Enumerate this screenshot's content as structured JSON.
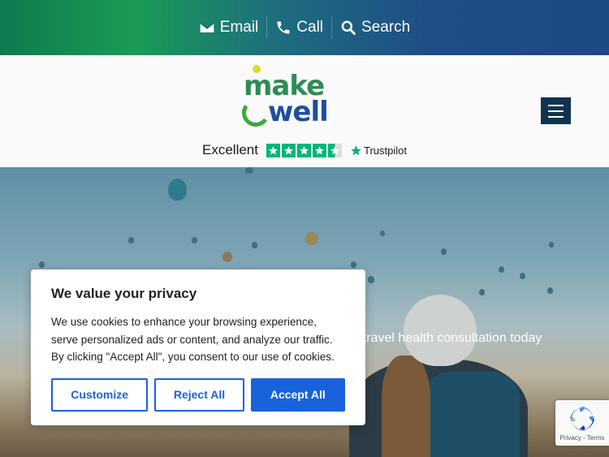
{
  "topbar": {
    "email_label": "Email",
    "call_label": "Call",
    "search_label": "Search"
  },
  "header": {
    "logo_top": "make",
    "logo_bottom": "well",
    "trust_label": "Excellent",
    "trust_brand": "Trustpilot",
    "rating_stars": 4.5
  },
  "hero": {
    "tagline_fragment": "r travel health consultation today"
  },
  "cookie": {
    "title": "We value your privacy",
    "body": "We use cookies to enhance your browsing experience, serve personalized ads or content, and analyze our traffic. By clicking \"Accept All\", you consent to our use of cookies.",
    "customize_label": "Customize",
    "reject_label": "Reject All",
    "accept_label": "Accept All"
  },
  "recaptcha": {
    "footer": "Privacy - Terms"
  },
  "colors": {
    "accent": "#1863dc",
    "menu_button": "#10344f",
    "trustpilot_green": "#00b67a"
  }
}
